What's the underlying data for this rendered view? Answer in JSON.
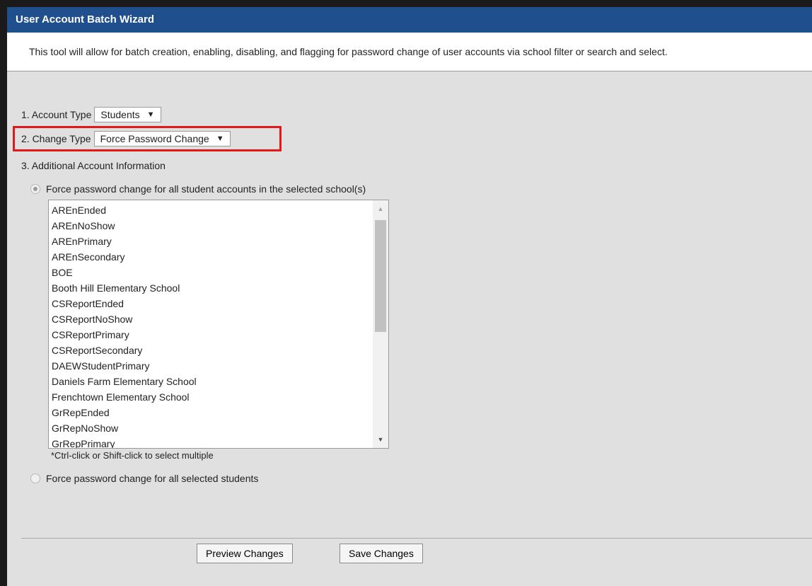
{
  "window": {
    "title": "User Account Batch Wizard",
    "description": "This tool will allow for batch creation, enabling, disabling, and flagging for password change of user accounts via school filter or search and select."
  },
  "step1": {
    "label": "1. Account Type",
    "selected": "Students"
  },
  "step2": {
    "label": "2. Change Type",
    "selected": "Force Password Change"
  },
  "step3": {
    "label": "3. Additional Account Information"
  },
  "options": {
    "by_school": {
      "label": "Force password change for all student accounts in the selected school(s)",
      "checked": true
    },
    "by_student": {
      "label": "Force password change for all selected students",
      "checked": false
    }
  },
  "school_list": {
    "items": [
      "AREnEnded",
      "AREnNoShow",
      "AREnPrimary",
      "AREnSecondary",
      "BOE",
      "Booth Hill Elementary School",
      "CSReportEnded",
      "CSReportNoShow",
      "CSReportPrimary",
      "CSReportSecondary",
      "DAEWStudentPrimary",
      "Daniels Farm Elementary School",
      "Frenchtown Elementary School",
      "GrRepEnded",
      "GrRepNoShow",
      "GrRepPrimary"
    ],
    "hint": "*Ctrl-click or Shift-click to select multiple"
  },
  "buttons": {
    "preview": "Preview Changes",
    "save": "Save Changes"
  },
  "colors": {
    "title_bar": "#1f4f8c",
    "highlight": "#e01a1a"
  },
  "icons": {
    "dropdown": "▼",
    "scroll_up": "▲",
    "scroll_down": "▼"
  }
}
